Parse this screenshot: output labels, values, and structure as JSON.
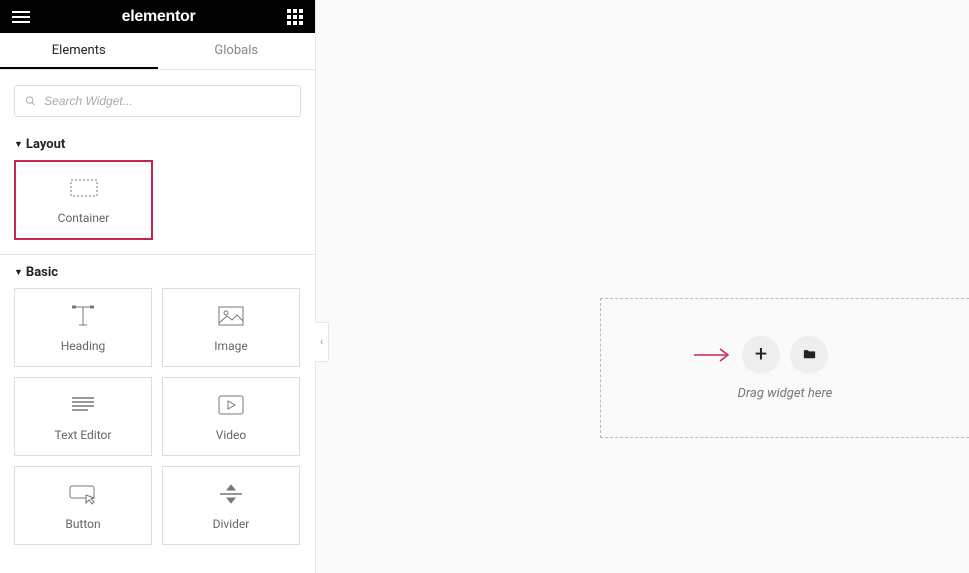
{
  "header": {
    "logo": "elementor"
  },
  "tabs": {
    "elements": "Elements",
    "globals": "Globals"
  },
  "search": {
    "placeholder": "Search Widget..."
  },
  "sections": {
    "layout": {
      "title": "Layout",
      "widgets": {
        "container": "Container"
      }
    },
    "basic": {
      "title": "Basic",
      "widgets": {
        "heading": "Heading",
        "image": "Image",
        "text_editor": "Text Editor",
        "video": "Video",
        "button": "Button",
        "divider": "Divider"
      }
    }
  },
  "canvas": {
    "drop_hint": "Drag widget here"
  }
}
